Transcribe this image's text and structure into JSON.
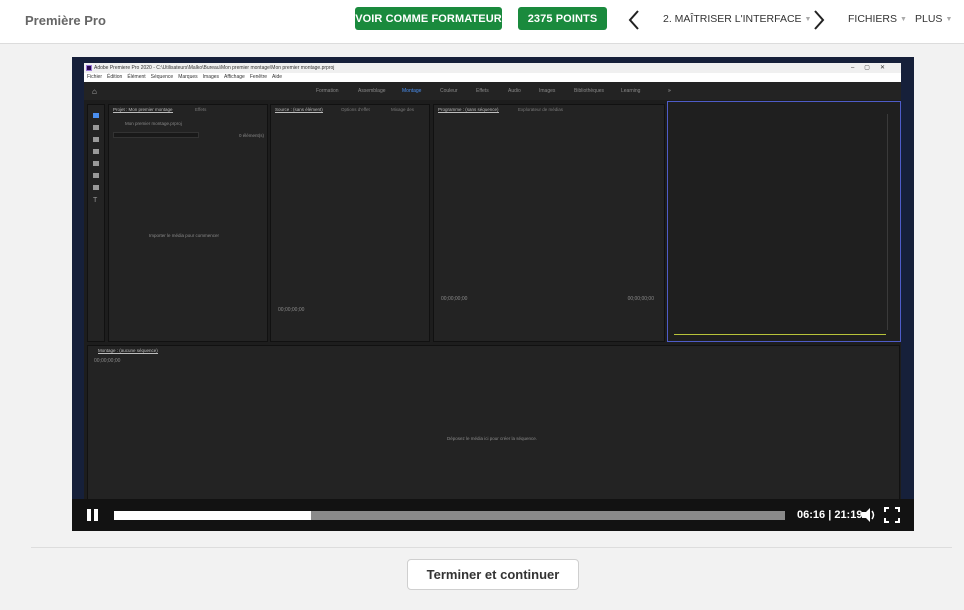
{
  "header": {
    "app_title": "Première Pro",
    "trainer_button": "VOIR COMME FORMATEUR",
    "points_button": "2375 POINTS",
    "chapter": "2. MAÎTRISER L'INTERFACE",
    "files_menu": "FICHIERS",
    "more_menu": "PLUS"
  },
  "premiere": {
    "window_title": "Adobe Premiere Pro 2020 - C:\\Utilisateurs\\Malko\\Bureau\\Mon premier montage\\Mon premier montage.prproj",
    "menus": [
      "Fichier",
      "Édition",
      "Élément",
      "Séquence",
      "Marques",
      "Images",
      "Affichage",
      "Fenêtre",
      "Aide"
    ],
    "workspaces": [
      "Formation",
      "Assemblage",
      "Montage",
      "Couleur",
      "Effets",
      "Audio",
      "Images",
      "Bibliothèques",
      "Learning"
    ],
    "active_workspace": "Montage",
    "project_tab": "Projet : Mon premier montage",
    "effects_tab": "Effets",
    "project_file": "Mon premier montage.prproj",
    "project_count": "0 élément(s)",
    "project_hint": "Importer le média pour commencer",
    "source_tab": "Source : (sans élément)",
    "effect_options_tab": "Options d'effet",
    "audio_mixer_tab": "Mixage des",
    "source_timecode": "00;00;00;00",
    "program_tab": "Programme : (sans séquence)",
    "media_browser_tab": "Explorateur de médias",
    "program_timecode_left": "00;00;00;00",
    "program_timecode_right": "00;00;00;00",
    "timeline_tab": "Montage : (aucune séquence)",
    "timeline_timecode": "00;00;00;00",
    "timeline_hint": "Déposez le média ici pour créer la séquence."
  },
  "player": {
    "time": "06:16 | 21:19",
    "progress": 0.293
  },
  "footer": {
    "finish_button": "Terminer et continuer"
  },
  "colors": {
    "brand_green": "#1a8a3d",
    "premiere_accent": "#4a8ff0"
  }
}
